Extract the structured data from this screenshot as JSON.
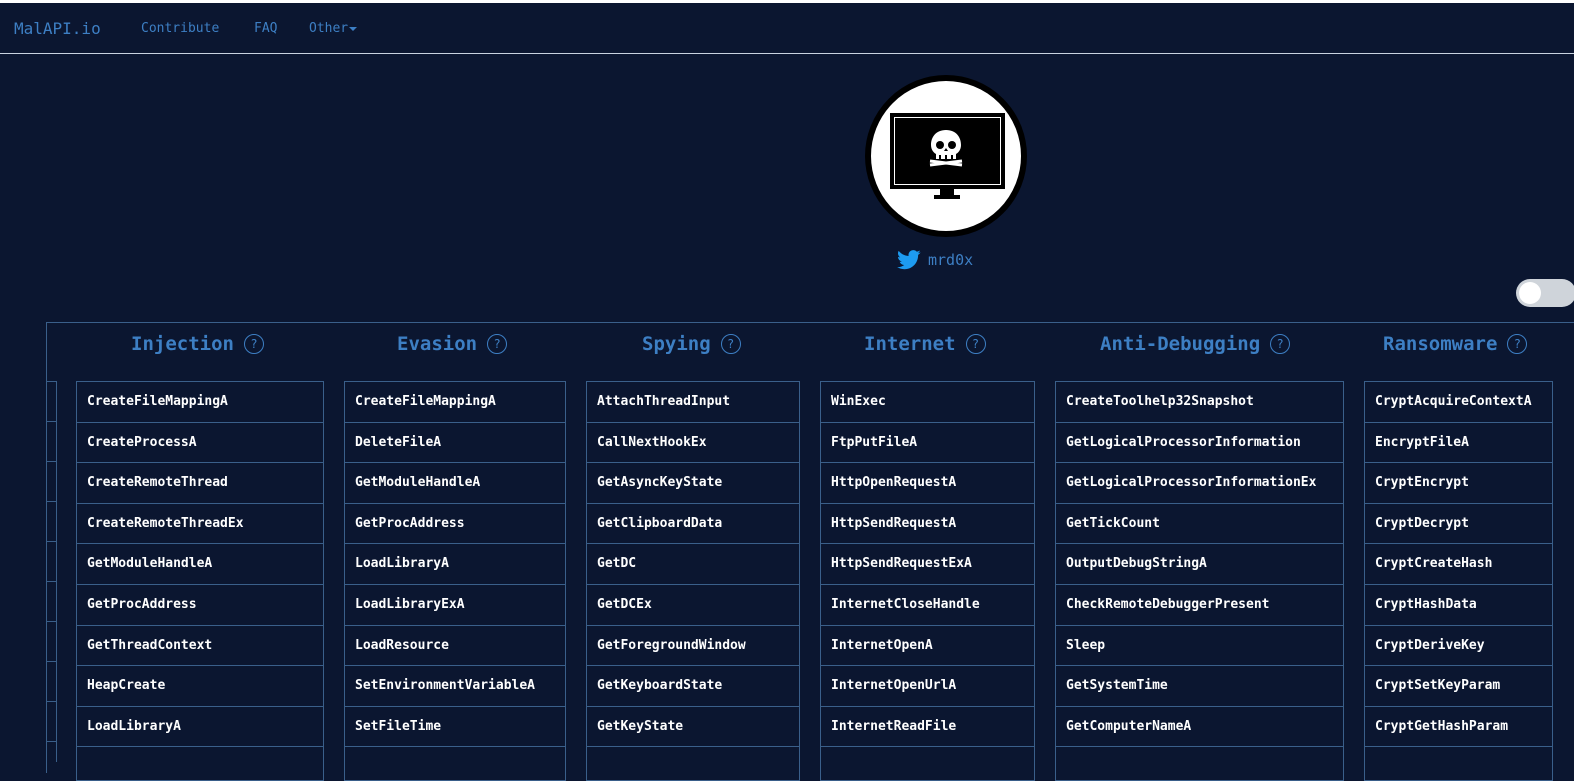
{
  "nav": {
    "brand": "MalAPI.io",
    "links": [
      "Contribute",
      "FAQ",
      "Other"
    ]
  },
  "profile": {
    "handle": "mrd0x",
    "icon": "twitter-icon"
  },
  "colors": {
    "background": "#0b1630",
    "accent": "#3d7fc4",
    "text": "#ffffff",
    "border": "#3a5f8a"
  },
  "columns": [
    {
      "title": "Injection",
      "items": [
        "CreateFileMappingA",
        "CreateProcessA",
        "CreateRemoteThread",
        "CreateRemoteThreadEx",
        "GetModuleHandleA",
        "GetProcAddress",
        "GetThreadContext",
        "HeapCreate",
        "LoadLibraryA"
      ]
    },
    {
      "title": "Evasion",
      "items": [
        "CreateFileMappingA",
        "DeleteFileA",
        "GetModuleHandleA",
        "GetProcAddress",
        "LoadLibraryA",
        "LoadLibraryExA",
        "LoadResource",
        "SetEnvironmentVariableA",
        "SetFileTime"
      ]
    },
    {
      "title": "Spying",
      "items": [
        "AttachThreadInput",
        "CallNextHookEx",
        "GetAsyncKeyState",
        "GetClipboardData",
        "GetDC",
        "GetDCEx",
        "GetForegroundWindow",
        "GetKeyboardState",
        "GetKeyState"
      ]
    },
    {
      "title": "Internet",
      "items": [
        "WinExec",
        "FtpPutFileA",
        "HttpOpenRequestA",
        "HttpSendRequestA",
        "HttpSendRequestExA",
        "InternetCloseHandle",
        "InternetOpenA",
        "InternetOpenUrlA",
        "InternetReadFile"
      ]
    },
    {
      "title": "Anti-Debugging",
      "items": [
        "CreateToolhelp32Snapshot",
        "GetLogicalProcessorInformation",
        "GetLogicalProcessorInformationEx",
        "GetTickCount",
        "OutputDebugStringA",
        "CheckRemoteDebuggerPresent",
        "Sleep",
        "GetSystemTime",
        "GetComputerNameA"
      ]
    },
    {
      "title": "Ransomware",
      "items": [
        "CryptAcquireContextA",
        "EncryptFileA",
        "CryptEncrypt",
        "CryptDecrypt",
        "CryptCreateHash",
        "CryptHashData",
        "CryptDeriveKey",
        "CryptSetKeyParam",
        "CryptGetHashParam"
      ]
    }
  ]
}
